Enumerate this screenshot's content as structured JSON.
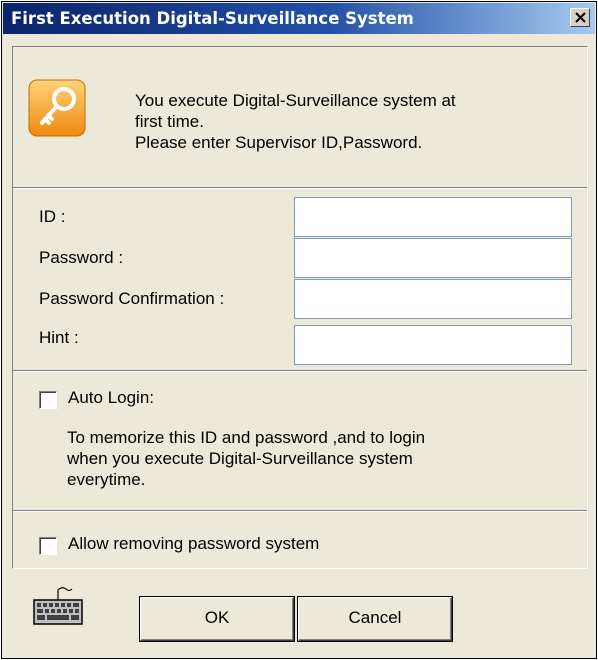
{
  "window": {
    "title": "First Execution Digital-Surveillance System",
    "close_glyph": "X"
  },
  "header": {
    "icon": "key-icon",
    "message_line1": "You execute Digital-Surveillance system at",
    "message_line2": "first time.",
    "message_line3": "Please enter Supervisor ID,Password."
  },
  "form": {
    "fields": [
      {
        "label": "ID :",
        "value": ""
      },
      {
        "label": "Password :",
        "value": ""
      },
      {
        "label": "Password Confirmation :",
        "value": ""
      },
      {
        "label": "Hint :",
        "value": ""
      }
    ]
  },
  "auto_login": {
    "label": "Auto Login:",
    "checked": false,
    "desc_line1": "To memorize this ID and password ,and to login",
    "desc_line2": "when you execute Digital-Surveillance system",
    "desc_line3": "everytime."
  },
  "allow_remove": {
    "label": "Allow removing password system",
    "checked": false
  },
  "footer": {
    "icon": "keyboard-icon",
    "ok_label": "OK",
    "cancel_label": "Cancel"
  },
  "colors": {
    "title_bar_start": "#0a246a",
    "title_bar_end": "#a6caf0",
    "dialog_bg": "#ece9d8",
    "key_icon": "#f5a623"
  }
}
